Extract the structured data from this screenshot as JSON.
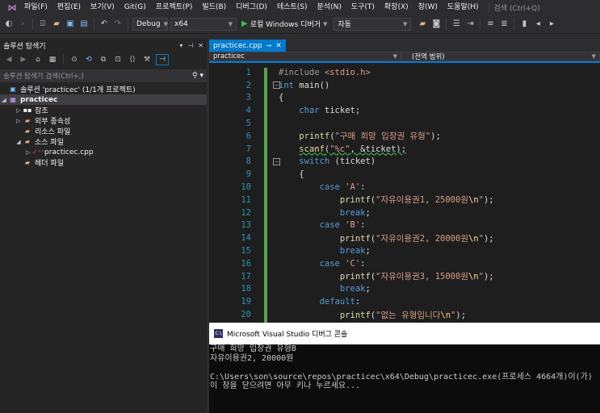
{
  "menu": {
    "items": [
      "파일(F)",
      "편집(E)",
      "보기(V)",
      "Git(G)",
      "프로젝트(P)",
      "빌드(B)",
      "디버그(D)",
      "테스트(S)",
      "분석(N)",
      "도구(T)",
      "확장(X)",
      "창(W)",
      "도움말(H)"
    ],
    "search": "검색 (Ctrl+Q)"
  },
  "toolbar": {
    "config": "Debug",
    "platform": "x64",
    "run_label": "로컬 Windows 디버거",
    "run_mode": "자동"
  },
  "solution_explorer": {
    "title": "솔루션 탐색기",
    "search_placeholder": "솔루션 탐색기 검색(Ctrl+;)",
    "tree": [
      {
        "label": "솔루션 'practicec' (1/1개 프로젝트)",
        "icon": "solution-icon"
      },
      {
        "label": "practicec",
        "icon": "project-icon"
      },
      {
        "label": "참조",
        "icon": "references-icon"
      },
      {
        "label": "외부 종속성",
        "icon": "folder-icon"
      },
      {
        "label": "리소스 파일",
        "icon": "folder-icon"
      },
      {
        "label": "소스 파일",
        "icon": "folder-icon"
      },
      {
        "label": "practicec.cpp",
        "icon": "cpp-file-icon"
      },
      {
        "label": "헤더 파일",
        "icon": "folder-icon"
      }
    ]
  },
  "editor": {
    "tab": "practicec.cpp",
    "nav_project": "practicec",
    "nav_scope": "(전역 범위)",
    "lines": [
      {
        "n": "1",
        "text": "#include <stdio.h>"
      },
      {
        "n": "2",
        "text": "int main()"
      },
      {
        "n": "3",
        "text": "{"
      },
      {
        "n": "4",
        "text": "    char ticket;"
      },
      {
        "n": "5",
        "text": ""
      },
      {
        "n": "6",
        "text": "    printf(\"구매 희망 입장권 유형\");"
      },
      {
        "n": "7",
        "text": "    scanf(\"%c\", &ticket);"
      },
      {
        "n": "8",
        "text": "    switch (ticket)"
      },
      {
        "n": "9",
        "text": "    {"
      },
      {
        "n": "10",
        "text": "        case 'A':"
      },
      {
        "n": "11",
        "text": "            printf(\"자유이용권1, 25000원\\n\");"
      },
      {
        "n": "12",
        "text": "            break;"
      },
      {
        "n": "13",
        "text": "        case 'B':"
      },
      {
        "n": "14",
        "text": "            printf(\"자유이용권2, 20000원\\n\");"
      },
      {
        "n": "15",
        "text": "            break;"
      },
      {
        "n": "16",
        "text": "        case 'C':"
      },
      {
        "n": "17",
        "text": "            printf(\"자유이용권3, 15000원\\n\");"
      },
      {
        "n": "18",
        "text": "            break;"
      },
      {
        "n": "19",
        "text": "        default:"
      },
      {
        "n": "20",
        "text": "            printf(\"없는 유형입니다\\n\");"
      }
    ]
  },
  "console": {
    "title": "Microsoft Visual Studio 디버그 콘솔",
    "lines": [
      "구매 희망 입장권 유형B",
      "자유이용권2, 20000원",
      "",
      "C:\\Users\\son\\source\\repos\\practicec\\x64\\Debug\\practicec.exe(프로세스 4664개)이(가)",
      "이 창을 닫으려면 아무 키나 누르세요..."
    ]
  },
  "colors": {
    "accent": "#007acc",
    "editor_bg": "#1e1e1e",
    "keyword": "#569cd6",
    "string": "#d69d85",
    "line_number": "#2b91af"
  }
}
